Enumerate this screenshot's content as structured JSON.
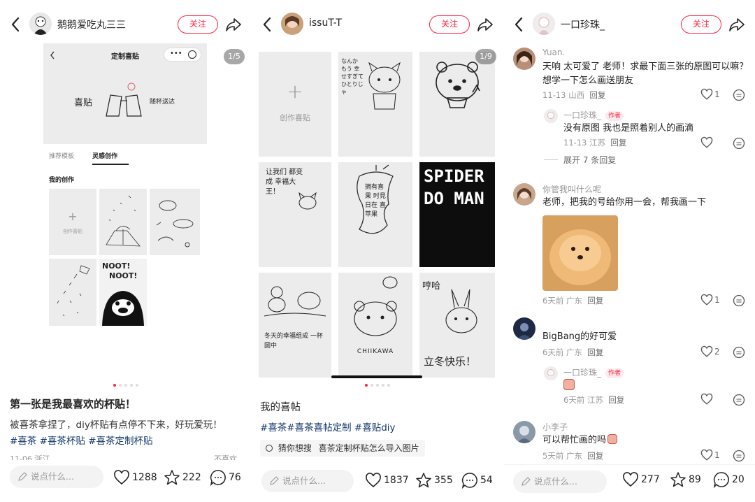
{
  "panels": [
    {
      "user": "鹅鹅爱吃丸三三",
      "follow": "关注",
      "counter": "1/5",
      "app": {
        "title": "定制喜贴",
        "banner_text_left": "喜贴",
        "banner_text_right": "随杯送达",
        "tabs": [
          "推荐模板",
          "灵感创作"
        ],
        "section": "我的创作",
        "create": "创作喜贴",
        "noot": "NOOT!",
        "noot2": "NOOT!"
      },
      "title": "第一张是我最喜欢的杯贴！",
      "desc": "被喜茶拿捏了，diy杯贴有点停不下来，好玩爱玩！",
      "tags": "#喜茶 #喜茶杯贴 #喜茶定制杯贴",
      "meta": "11-06 浙江",
      "meta_right": "不喜欢",
      "input": "说点什么...",
      "likes": "1288",
      "stars": "222",
      "comments": "76"
    },
    {
      "user": "issuT-T",
      "follow": "关注",
      "counter": "1/9",
      "create": "创作喜贴",
      "art": {
        "hand1": "なんか もう 幸せすぎて ひとりじゃ",
        "hand2": "让我们 都变成 幸福大王！",
        "apple": "拥有喜果 时見 日在 喜苹果",
        "spider": "SPIDER DO MAN",
        "winter": "冬天的幸福组成 一杯圆中",
        "chiikawa": "CHIIKAWA",
        "lichun": "立冬快乐！",
        "lichun2": "哼哈"
      },
      "title": "我的喜帖",
      "tags": "#喜茶#喜茶喜帖定制 #喜贴diy",
      "search_prefix": "猜你想搜",
      "search": "喜茶定制杯贴怎么导入图片",
      "input": "说点什么...",
      "likes": "1837",
      "stars": "355",
      "comments": "54"
    },
    {
      "user": "一口珍珠_",
      "follow": "关注",
      "comments_list": [
        {
          "name": "Yuan.",
          "text1": "天响 太可爱了 老师！求最下面三张的原图可以嘛？",
          "text2": "想学一下怎么画送朋友",
          "meta": "11-13 山西",
          "reply": "回复",
          "likes": "1"
        },
        {
          "name": "一口珍珠_",
          "tag": "作者",
          "text1": "没有原图 我也是照着别人的画滴",
          "meta": "11-13 江苏",
          "reply": "回复",
          "likes": ""
        },
        {
          "expand": "展开 7 条回复"
        },
        {
          "name": "你管我叫什么呢",
          "text1": "老师，把我的号给你用一会，帮我画一下",
          "meta": "6天前 广东",
          "reply": "回复",
          "likes": "1"
        },
        {
          "name": "",
          "text1": "BigBang的好可爱",
          "meta": "6天前 广东",
          "reply": "回复",
          "likes": "2"
        },
        {
          "name": "一口珍珠_",
          "tag": "作者",
          "meta": "6天前 江苏",
          "reply": "回复",
          "likes": ""
        },
        {
          "name": "小李子",
          "text1": "可以帮忙画的吗",
          "meta": "5天前 广东",
          "reply": "回复",
          "likes": "1"
        }
      ],
      "input": "说点什么...",
      "likes": "277",
      "stars": "89",
      "comments": "20"
    }
  ],
  "colors": {
    "accent": "#ff2442",
    "tag": "#13386c"
  }
}
